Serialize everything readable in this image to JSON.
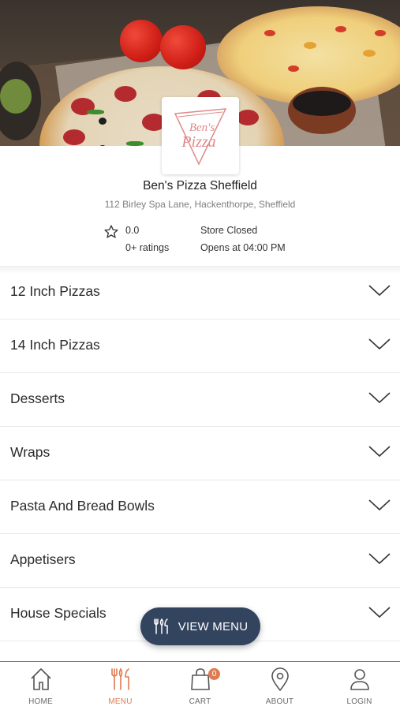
{
  "store": {
    "name": "Ben's Pizza Sheffield",
    "address": "112 Birley Spa Lane, Hackenthorpe, Sheffield",
    "rating": "0.0",
    "ratings_count": "0+ ratings",
    "status": "Store Closed",
    "hours": "Opens at 04:00 PM",
    "logo_text_top": "Ben's",
    "logo_text_bottom": "Pizza"
  },
  "categories": [
    {
      "label": "12 Inch Pizzas"
    },
    {
      "label": "14 Inch Pizzas"
    },
    {
      "label": "Desserts"
    },
    {
      "label": "Wraps"
    },
    {
      "label": "Pasta And Bread Bowls"
    },
    {
      "label": "Appetisers"
    },
    {
      "label": "House Specials"
    }
  ],
  "view_menu": {
    "label": "VIEW MENU"
  },
  "tabs": [
    {
      "label": "HOME",
      "icon": "home-icon"
    },
    {
      "label": "MENU",
      "icon": "cutlery-icon"
    },
    {
      "label": "CART",
      "icon": "bag-icon"
    },
    {
      "label": "ABOUT",
      "icon": "location-pin-icon"
    },
    {
      "label": "LOGIN",
      "icon": "user-icon"
    }
  ],
  "cart_badge": "0",
  "colors": {
    "accent": "#e07b4f",
    "button": "#33445f",
    "logo": "#e08a8a"
  }
}
